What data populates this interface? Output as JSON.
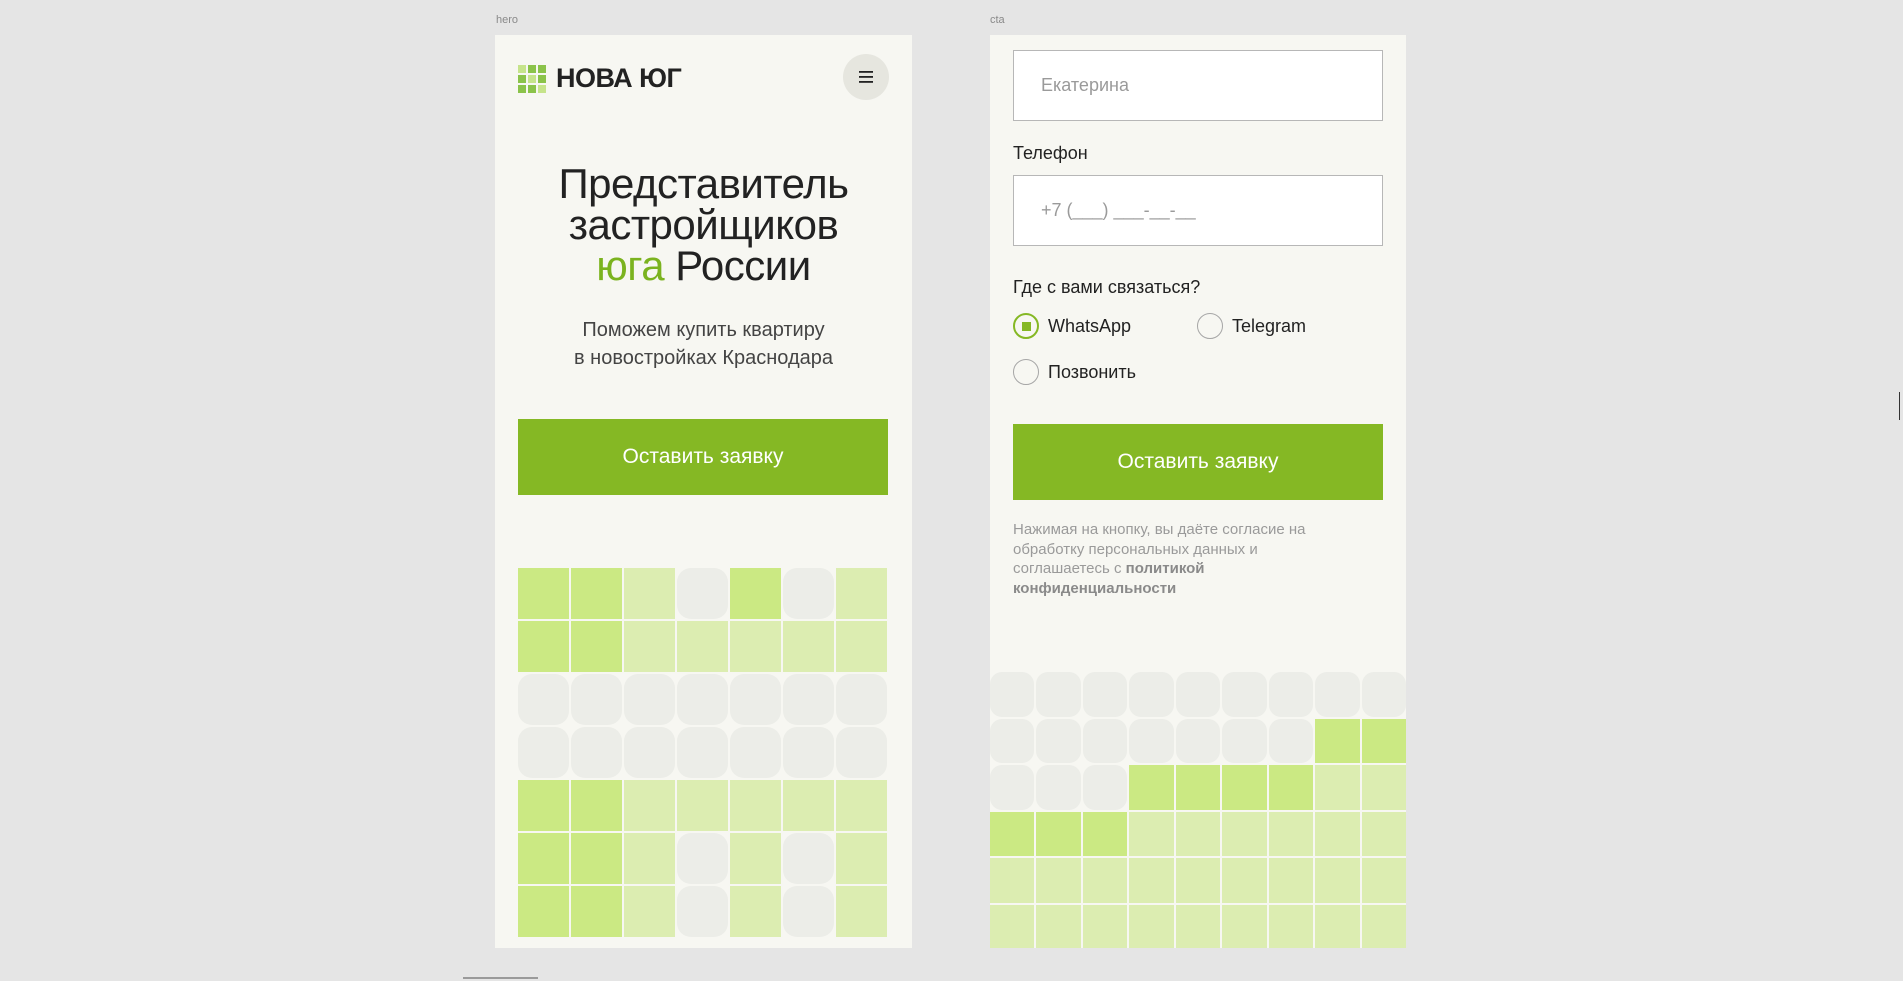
{
  "frames": {
    "hero_label": "hero",
    "cta_label": "cta"
  },
  "hero": {
    "logo_text": "НОВА ЮГ",
    "menu_icon": "hamburger-icon",
    "title_line1": "Представитель",
    "title_line2": "застройщиков",
    "title_accent": "юга",
    "title_line3_rest": " России",
    "subtitle_line1": "Поможем купить квартиру",
    "subtitle_line2": "в новостройках Краснодара",
    "button_label": "Оставить заявку"
  },
  "cta": {
    "name_placeholder": "Екатерина",
    "phone_label": "Телефон",
    "phone_placeholder": "+7 (___) ___-__-__",
    "contact_label": "Где с вами связаться?",
    "options": [
      {
        "label": "WhatsApp",
        "checked": true
      },
      {
        "label": "Telegram",
        "checked": false
      },
      {
        "label": "Позвонить",
        "checked": false
      }
    ],
    "button_label": "Оставить заявку",
    "consent_text": "Нажимая на кнопку, вы даёте согласие на обработку персональных данных и соглашаетесь с ",
    "consent_link": "политикой конфиденциальности"
  },
  "colors": {
    "accent": "#85b824",
    "accent_text": "#7bb31f",
    "tile_dark": "#cbe983",
    "tile_light": "#dcedb1",
    "tile_grey": "#ecede8",
    "frame_bg": "#f7f7f2"
  },
  "hero_grid": [
    "gglpgpl",
    "gglllll",
    "ppppppp",
    "ppppppp",
    "ggllll l",
    "gglplpl",
    "gglplpl"
  ],
  "cta_grid": [
    "ppppppppp",
    "pppppppgg",
    "pppggggll",
    "ggglllllll",
    "lllllllll",
    "lllllllll"
  ]
}
